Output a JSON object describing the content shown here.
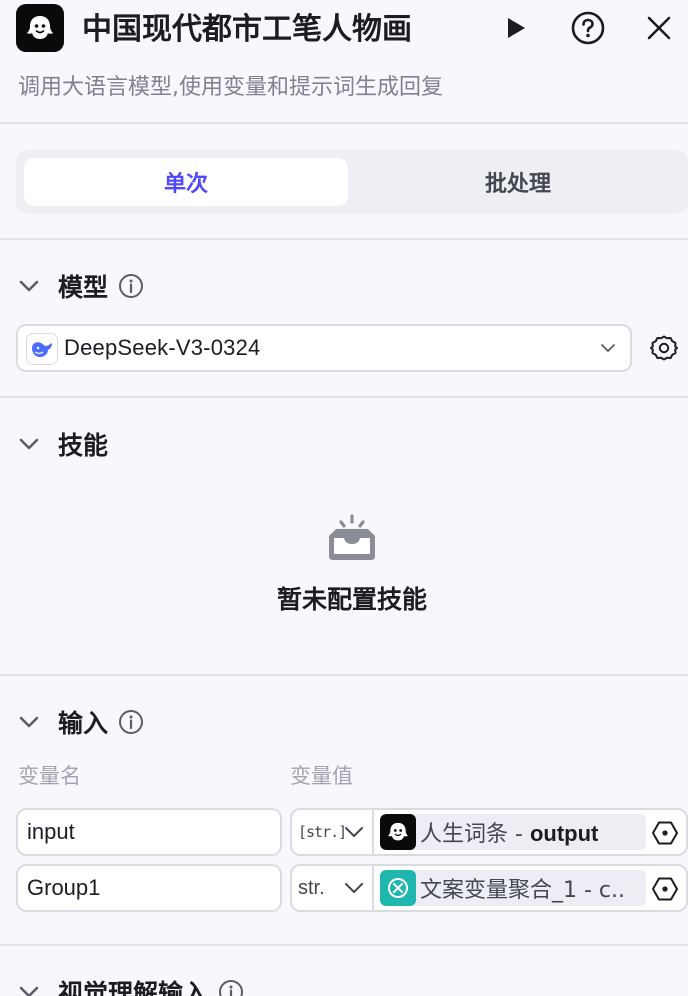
{
  "header": {
    "title": "中国现代都市工笔人物画",
    "subtitle": "调用大语言模型,使用变量和提示词生成回复"
  },
  "mode_tabs": [
    {
      "label": "单次",
      "active": true
    },
    {
      "label": "批处理",
      "active": false
    }
  ],
  "sections": {
    "model": {
      "label": "模型",
      "selected_model": "DeepSeek-V3-0324"
    },
    "skills": {
      "label": "技能",
      "empty_text": "暂未配置技能"
    },
    "input": {
      "label": "输入",
      "col_name": "变量名",
      "col_value": "变量值",
      "rows": [
        {
          "name": "input",
          "type": "[str.]",
          "ref_node": "人生词条 - ",
          "ref_field": "output"
        },
        {
          "name": "Group1",
          "type": "str.",
          "ref_node": "文案变量聚合_1 - c..",
          "ref_field": ""
        }
      ]
    },
    "vision_input": {
      "label": "视觉理解输入"
    }
  },
  "colors": {
    "accent": "#5147ff",
    "bot_logo_bg": "#0a0a0a",
    "aggregate_icon_bg": "#1fb6ad"
  }
}
